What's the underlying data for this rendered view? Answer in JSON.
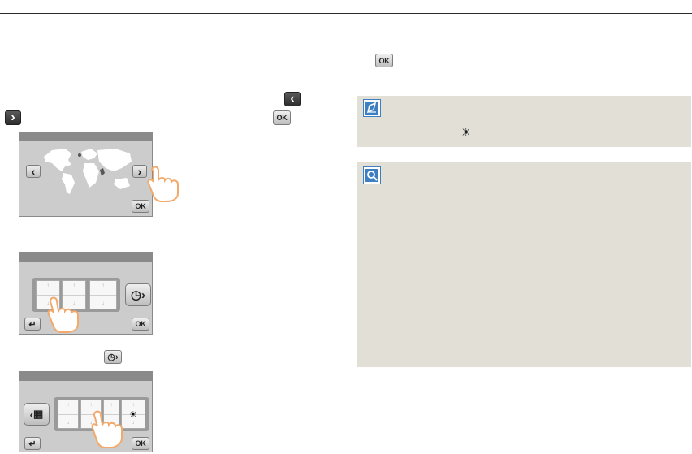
{
  "icons": {
    "ok_label": "OK",
    "left_arrow": "‹",
    "right_arrow": "›",
    "back_arrow": "↵",
    "sun": "☀",
    "clock": "◷",
    "calendar": "▦"
  },
  "colors": {
    "note_bg": "#e2e0d6",
    "note_icon": "#3d7fc0",
    "panel_bg": "#cccccc",
    "panel_header": "#8a8a8a",
    "hand": "#f2a96b"
  }
}
